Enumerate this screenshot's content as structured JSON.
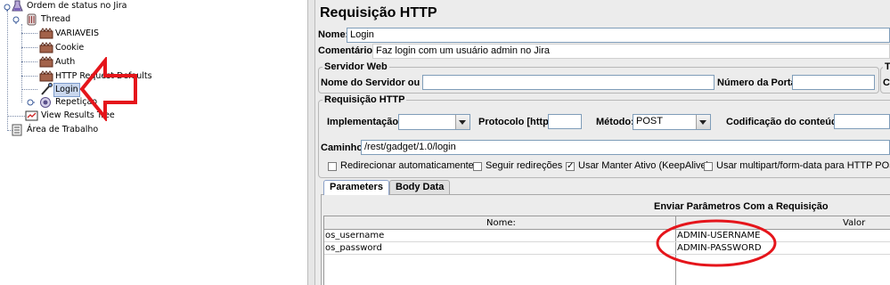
{
  "tree": {
    "test_plan": "Ordem de status no Jira",
    "thread": "Thread",
    "items": [
      "VARIAVEIS",
      "Cookie",
      "Auth",
      "HTTP Request Defaults",
      "Login",
      "Repetição"
    ],
    "view_results": "View Results Tree",
    "workbench": "Área de Trabalho"
  },
  "panel": {
    "title": "Requisição HTTP",
    "name_label": "Nome:",
    "name_value": "Login",
    "comments_label": "Comentários:",
    "comments_value": "Faz login com um usuário admin no Jira",
    "web_server": {
      "title": "Servidor Web",
      "server_label": "Nome do Servidor ou IP:",
      "server_value": "",
      "port_label": "Número da Porta:",
      "port_value": "",
      "cut_title": "T",
      "cut_label": "C"
    },
    "http_request": {
      "title": "Requisição HTTP",
      "impl_label": "Implementação:",
      "impl_value": "",
      "protocol_label": "Protocolo [http]:",
      "protocol_value": "",
      "method_label": "Método:",
      "method_value": "POST",
      "encoding_label": "Codificação do conteúdo:",
      "encoding_value": "",
      "path_label": "Caminho:",
      "path_value": "/rest/gadget/1.0/login"
    },
    "options": [
      {
        "label": "Redirecionar automaticamente",
        "checked": false
      },
      {
        "label": "Seguir redireções",
        "checked": false
      },
      {
        "label": "Usar Manter Ativo (KeepAlive)",
        "checked": true
      },
      {
        "label": "Usar multipart/form-data para HTTP POST",
        "checked": false
      }
    ],
    "tabs": [
      "Parameters",
      "Body Data"
    ],
    "params": {
      "title": "Enviar Parâmetros Com a Requisição",
      "col_name": "Nome:",
      "col_value": "Valor",
      "rows": [
        {
          "name": "os_username",
          "value": "ADMIN-USERNAME"
        },
        {
          "name": "os_password",
          "value": "ADMIN-PASSWORD"
        }
      ]
    }
  },
  "colors": {
    "annotation": "#e5151b",
    "selection": "#c9d7ee"
  }
}
